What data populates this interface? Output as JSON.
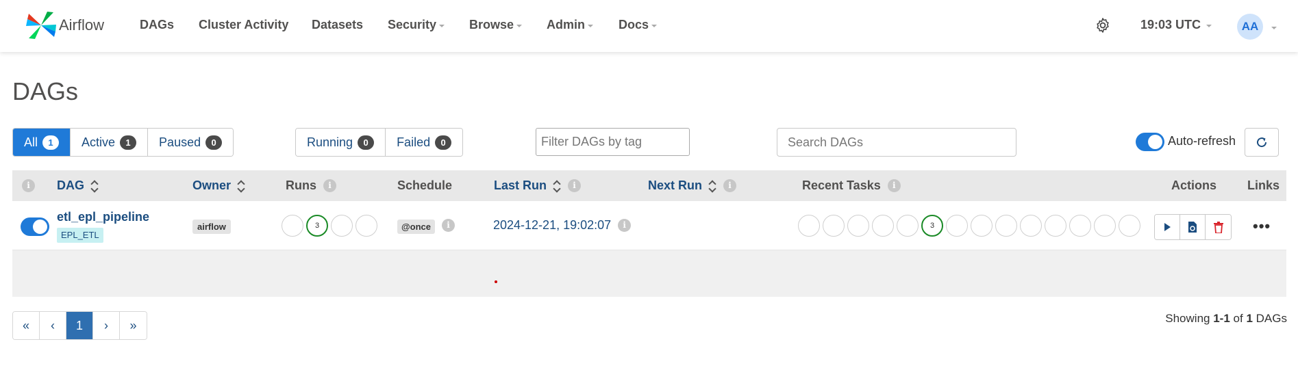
{
  "navbar": {
    "brand": "Airflow",
    "items": [
      {
        "label": "DAGs",
        "has_caret": false
      },
      {
        "label": "Cluster Activity",
        "has_caret": false
      },
      {
        "label": "Datasets",
        "has_caret": false
      },
      {
        "label": "Security",
        "has_caret": true
      },
      {
        "label": "Browse",
        "has_caret": true
      },
      {
        "label": "Admin",
        "has_caret": true
      },
      {
        "label": "Docs",
        "has_caret": true
      }
    ],
    "time": "19:03 UTC",
    "user_initials": "AA"
  },
  "page": {
    "title": "DAGs"
  },
  "filters": {
    "status": [
      {
        "label": "All",
        "count": "1",
        "active": true
      },
      {
        "label": "Active",
        "count": "1",
        "active": false
      },
      {
        "label": "Paused",
        "count": "0",
        "active": false
      }
    ],
    "runs": [
      {
        "label": "Running",
        "count": "0"
      },
      {
        "label": "Failed",
        "count": "0"
      }
    ],
    "tag_placeholder": "Filter DAGs by tag",
    "search_placeholder": "Search DAGs",
    "auto_refresh_label": "Auto-refresh",
    "auto_refresh_on": true
  },
  "table": {
    "headers": {
      "dag": "DAG",
      "owner": "Owner",
      "runs": "Runs",
      "schedule": "Schedule",
      "last_run": "Last Run",
      "next_run": "Next Run",
      "recent_tasks": "Recent Tasks",
      "actions": "Actions",
      "links": "Links"
    },
    "rows": [
      {
        "dag_id": "etl_epl_pipeline",
        "tag": "EPL_ETL",
        "active": true,
        "owner": "airflow",
        "runs": [
          "",
          "3",
          "",
          ""
        ],
        "schedule": "@once",
        "last_run": "2024-12-21, 19:02:07",
        "next_run": "",
        "recent_tasks": [
          "",
          "",
          "",
          "",
          "",
          "3",
          "",
          "",
          "",
          "",
          "",
          "",
          "",
          ""
        ]
      }
    ]
  },
  "pagination": {
    "first": "«",
    "prev": "‹",
    "current": "1",
    "next": "›",
    "last": "»",
    "showing_prefix": "Showing",
    "showing_range": "1-1",
    "showing_of": "of",
    "showing_total": "1",
    "showing_suffix": "DAGs"
  },
  "colors": {
    "primary": "#1f7ad8",
    "link": "#1b4d80",
    "success": "#1a8a26",
    "danger": "#d9242b"
  }
}
